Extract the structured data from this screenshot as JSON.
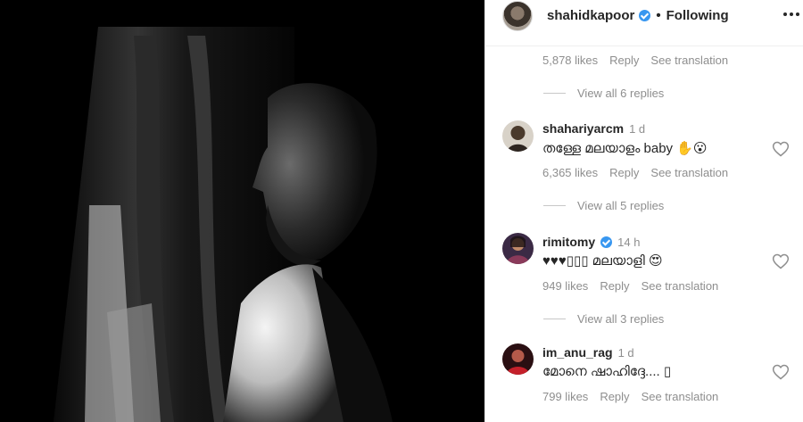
{
  "post": {
    "username": "shahidkapoor",
    "separator": "•",
    "follow_state": "Following"
  },
  "top_meta": {
    "likes": "5,878 likes",
    "reply_label": "Reply",
    "translate_label": "See translation"
  },
  "comments": [
    {
      "replies_above": "View all 6 replies",
      "username": "shahariyarcm",
      "time": "1 d",
      "text": "തള്ളേ മലയാളം baby ✋😮",
      "likes": "6,365 likes",
      "reply_label": "Reply",
      "translate_label": "See translation",
      "verified": false
    },
    {
      "replies_above": "View all 5 replies",
      "username": "rimitomy",
      "time": "14 h",
      "text": "♥♥♥▯▯▯ മലയാളി 😍",
      "likes": "949 likes",
      "reply_label": "Reply",
      "translate_label": "See translation",
      "verified": true
    },
    {
      "replies_above": "View all 3 replies",
      "username": "im_anu_rag",
      "time": "1 d",
      "text": "മോനെ ഷാഹിദ്ദേ.... ▯",
      "likes": "799 likes",
      "reply_label": "Reply",
      "translate_label": "See translation",
      "verified": false
    }
  ],
  "colors": {
    "verified": "#3897f0",
    "muted": "#8e8e8e",
    "text": "#262626"
  }
}
